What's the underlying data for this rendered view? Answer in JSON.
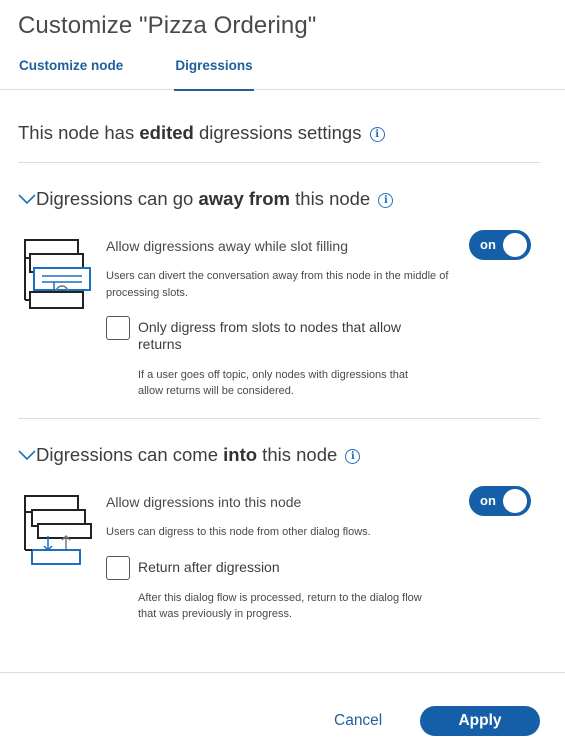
{
  "dialog": {
    "title": "Customize \"Pizza Ordering\""
  },
  "tabs": [
    {
      "label": "Customize node",
      "active": false
    },
    {
      "label": "Digressions",
      "active": true
    }
  ],
  "heading": {
    "prefix": "This node has ",
    "bold": "edited",
    "suffix": " digressions settings"
  },
  "away_section": {
    "title_prefix": "Digressions can go ",
    "title_bold": "away from",
    "title_suffix": " this node",
    "setting_label": "Allow digressions away while slot filling",
    "toggle_label": "on",
    "toggle_state": true,
    "description": "Users can divert the conversation away from this node in the middle of processing slots.",
    "checkbox_label": "Only digress from slots to nodes that allow returns",
    "checkbox_checked": false,
    "checkbox_description": "If a user goes off topic, only nodes with digressions that allow returns will be considered."
  },
  "into_section": {
    "title_prefix": "Digressions can come ",
    "title_bold": "into",
    "title_suffix": " this node",
    "setting_label": "Allow digressions into this node",
    "toggle_label": "on",
    "toggle_state": true,
    "description": "Users can digress to this node from other dialog flows.",
    "checkbox_label": "Return after digression",
    "checkbox_checked": false,
    "checkbox_description": "After this dialog flow is processed, return to the dialog flow that was previously in progress."
  },
  "footer": {
    "cancel_label": "Cancel",
    "apply_label": "Apply"
  },
  "colors": {
    "accent": "#155fa8",
    "link": "#1f5f9c",
    "info_icon": "#1f6fbf"
  },
  "icons": {
    "info": "info-icon",
    "chevron": "chevron-down-icon",
    "away_illustration": "digression-away-illustration",
    "into_illustration": "digression-into-illustration"
  }
}
